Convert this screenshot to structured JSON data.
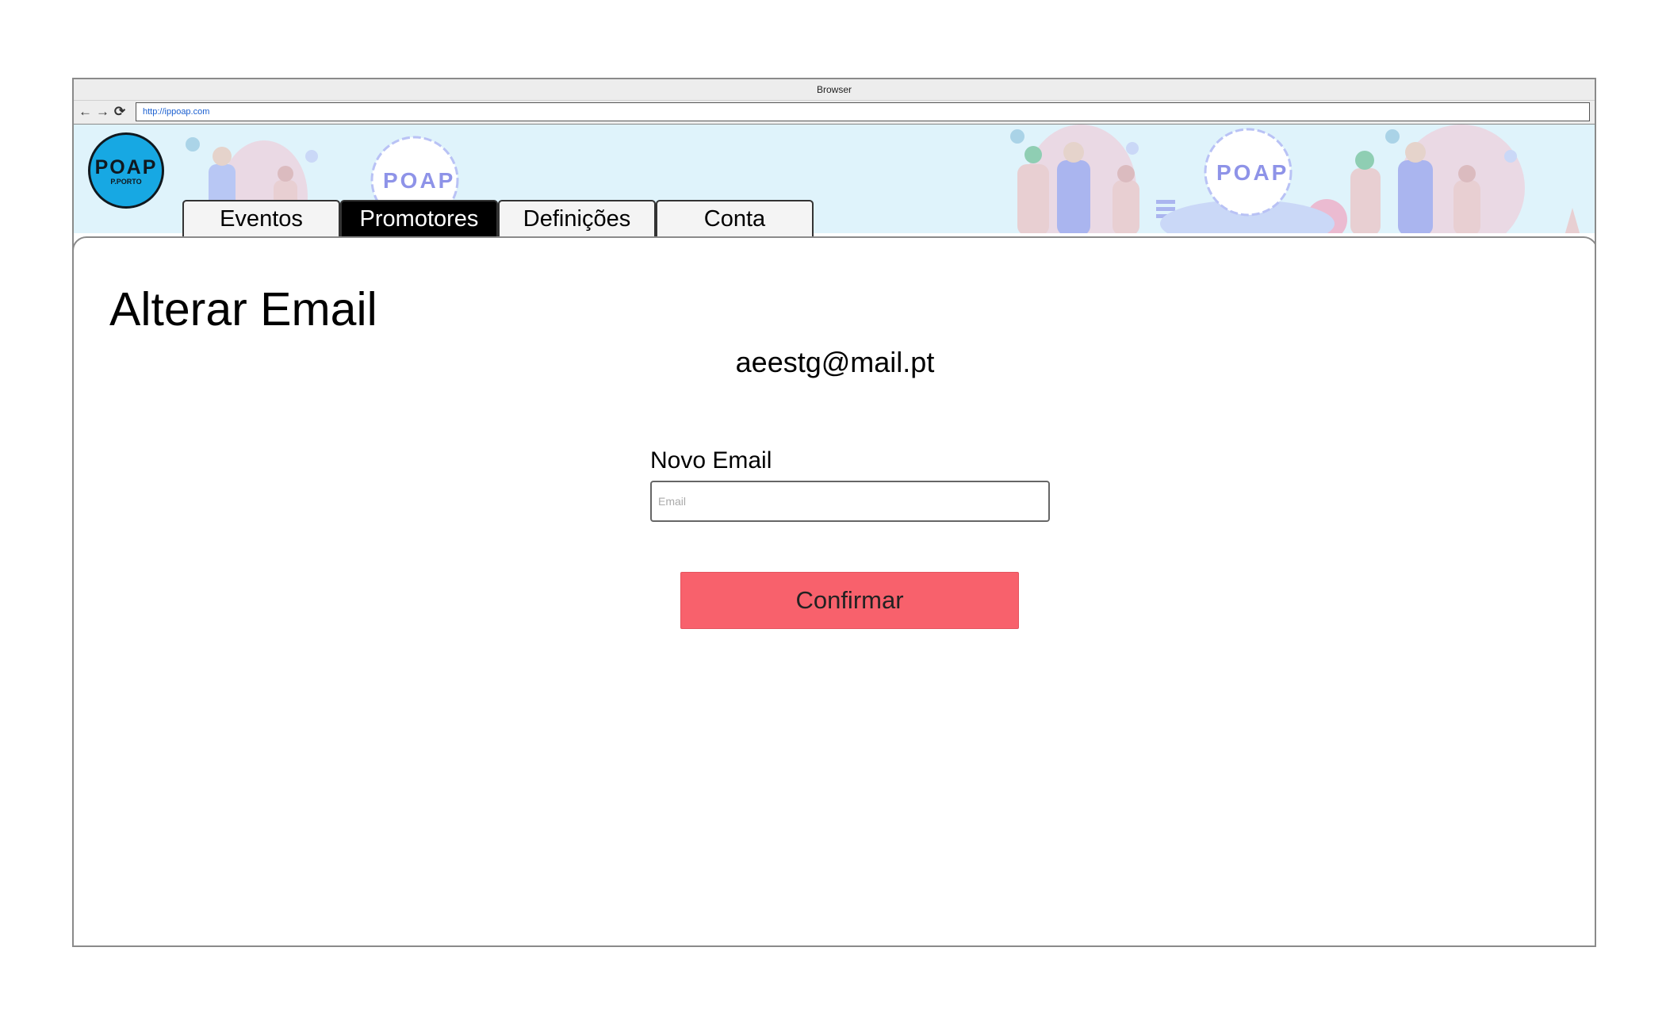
{
  "browser": {
    "title": "Browser",
    "url": "http://ippoap.com",
    "nav": {
      "back_icon": "arrow-left-icon",
      "forward_icon": "arrow-right-icon",
      "reload_icon": "reload-icon"
    }
  },
  "brand": {
    "logo_main": "POAP",
    "logo_sub": "P.PORTO",
    "banner_badge_text": "POAP"
  },
  "tabs": [
    {
      "label": "Eventos",
      "active": false
    },
    {
      "label": "Promotores",
      "active": true
    },
    {
      "label": "Definições",
      "active": false
    },
    {
      "label": "Conta",
      "active": false
    }
  ],
  "page": {
    "title": "Alterar Email",
    "current_email": "aeestg@mail.pt",
    "field_label": "Novo Email",
    "field_placeholder": "Email",
    "field_value": "",
    "confirm_label": "Confirmar"
  },
  "colors": {
    "accent": "#f8616c",
    "logo": "#17a8e3",
    "banner": "#dff3fb",
    "active_tab": "#000000"
  }
}
